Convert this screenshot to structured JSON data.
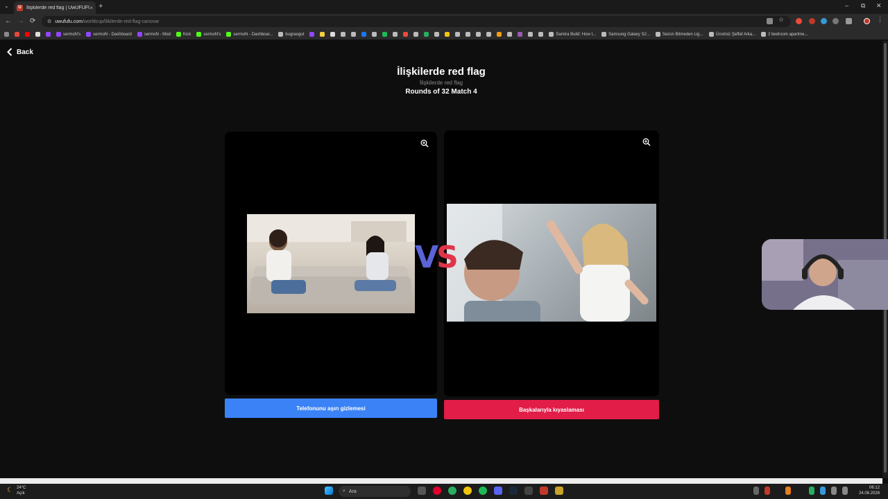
{
  "browser": {
    "tab_title": "İlişkilerde red flag | UwUFUFU",
    "tab_favicon_letter": "U",
    "new_tab": "+",
    "close_tab": "×",
    "url_host": "uwufufu.com",
    "url_path": "/worldcup/ilikilerde-red-flag-canovar",
    "nav_back": "←",
    "nav_forward": "→",
    "nav_reload": "⟳",
    "win_min": "–",
    "win_restore": "⧉",
    "win_close": "✕"
  },
  "bookmarks": [
    {
      "label": "",
      "color": "#8a8a8a"
    },
    {
      "label": "",
      "color": "#e5483b"
    },
    {
      "label": "",
      "color": "#ff0000"
    },
    {
      "label": "",
      "color": "#dddddd"
    },
    {
      "label": "",
      "color": "#9146ff"
    },
    {
      "label": "sermoN's",
      "color": "#9146ff"
    },
    {
      "label": "sermoN - Dashboard",
      "color": "#9146ff"
    },
    {
      "label": "sermoN - Mod",
      "color": "#9146ff"
    },
    {
      "label": "Kick",
      "color": "#53fc18"
    },
    {
      "label": "sermoN's",
      "color": "#53fc18"
    },
    {
      "label": "sermoN - Dashboar...",
      "color": "#53fc18"
    },
    {
      "label": "bugraogut",
      "color": "#bbbbbb"
    },
    {
      "label": "",
      "color": "#9146ff"
    },
    {
      "label": "",
      "color": "#f4d03f"
    },
    {
      "label": "",
      "color": "#dddddd"
    },
    {
      "label": "",
      "color": "#bbbbbb"
    },
    {
      "label": "",
      "color": "#bbbbbb"
    },
    {
      "label": "",
      "color": "#1877f2"
    },
    {
      "label": "",
      "color": "#bbbbbb"
    },
    {
      "label": "",
      "color": "#1db954"
    },
    {
      "label": "",
      "color": "#bbbbbb"
    },
    {
      "label": "",
      "color": "#e74c3c"
    },
    {
      "label": "",
      "color": "#bbbbbb"
    },
    {
      "label": "",
      "color": "#27ae60"
    },
    {
      "label": "",
      "color": "#bbbbbb"
    },
    {
      "label": "",
      "color": "#f1c40f"
    },
    {
      "label": "",
      "color": "#bbbbbb"
    },
    {
      "label": "",
      "color": "#bbbbbb"
    },
    {
      "label": "",
      "color": "#bbbbbb"
    },
    {
      "label": "",
      "color": "#bbbbbb"
    },
    {
      "label": "",
      "color": "#f39c12"
    },
    {
      "label": "",
      "color": "#bbbbbb"
    },
    {
      "label": "",
      "color": "#9b59b6"
    },
    {
      "label": "",
      "color": "#bbbbbb"
    },
    {
      "label": "",
      "color": "#bbbbbb"
    },
    {
      "label": "Samira Build: How t...",
      "color": "#bbbbbb"
    },
    {
      "label": "Samsung Galaxy S2...",
      "color": "#bbbbbb"
    },
    {
      "label": "Sezon Bitmeden Lig...",
      "color": "#bbbbbb"
    },
    {
      "label": "Ücretsiz Şeffaf Arka...",
      "color": "#bbbbbb"
    },
    {
      "label": "2 bedroom apartme...",
      "color": "#bbbbbb"
    }
  ],
  "page": {
    "back_label": "Back",
    "title": "İlişkilerde red flag",
    "subtitle": "İlişkilerde red flag",
    "round_info": "Rounds of 32 Match 4",
    "vs_v": "V",
    "vs_s": "S",
    "left_choice": "Telefonunu aşırı gizlemesi",
    "right_choice": "Başkalarıyla kıyaslaması",
    "left_color": "#3b82f6",
    "right_color": "#e11d48"
  },
  "taskbar": {
    "weather_temp": "24°C",
    "weather_desc": "Açık",
    "search_placeholder": "Ara",
    "time": "06:12",
    "date": "24.08.2026"
  }
}
